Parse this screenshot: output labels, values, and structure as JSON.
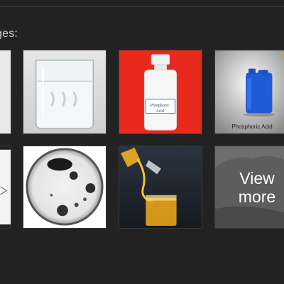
{
  "heading": "ges:",
  "thumbnails": {
    "bottle_label": "Phosphoric\nAcid",
    "drum_caption": "Phosphoric Acid",
    "drum_brand": "K",
    "view_more": "View\nmore"
  },
  "colors": {
    "page_bg": "#222222",
    "heading_text": "#cfcfcf",
    "red_bg": "#e8291c",
    "drum_blue": "#1f5bd6"
  }
}
